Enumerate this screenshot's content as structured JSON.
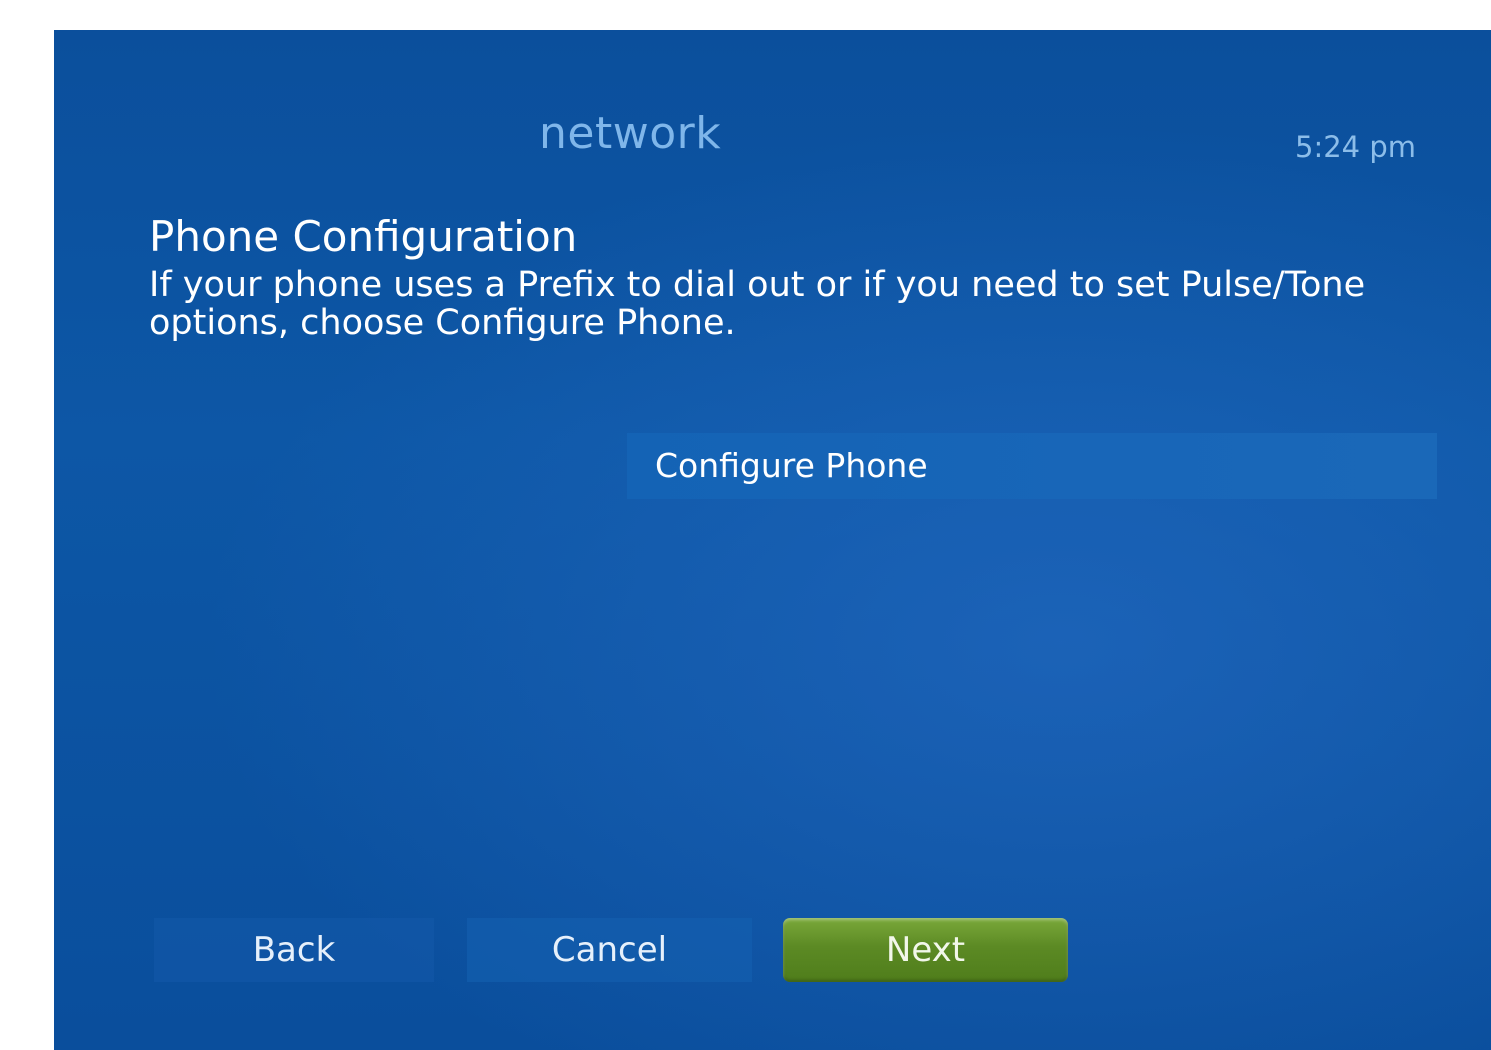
{
  "header": {
    "section_title": "network",
    "time": "5:24 pm"
  },
  "page": {
    "heading": "Phone Configuration",
    "description": "If your phone uses a Prefix to dial out or if you need to set Pulse/Tone options, choose Configure Phone."
  },
  "options": [
    {
      "label": "Configure Phone"
    }
  ],
  "navigation": {
    "back_label": "Back",
    "cancel_label": "Cancel",
    "next_label": "Next"
  },
  "colors": {
    "background": "#0b4f9c",
    "section_title": "#7fb6ea",
    "focused_button": "#5c8a24"
  }
}
